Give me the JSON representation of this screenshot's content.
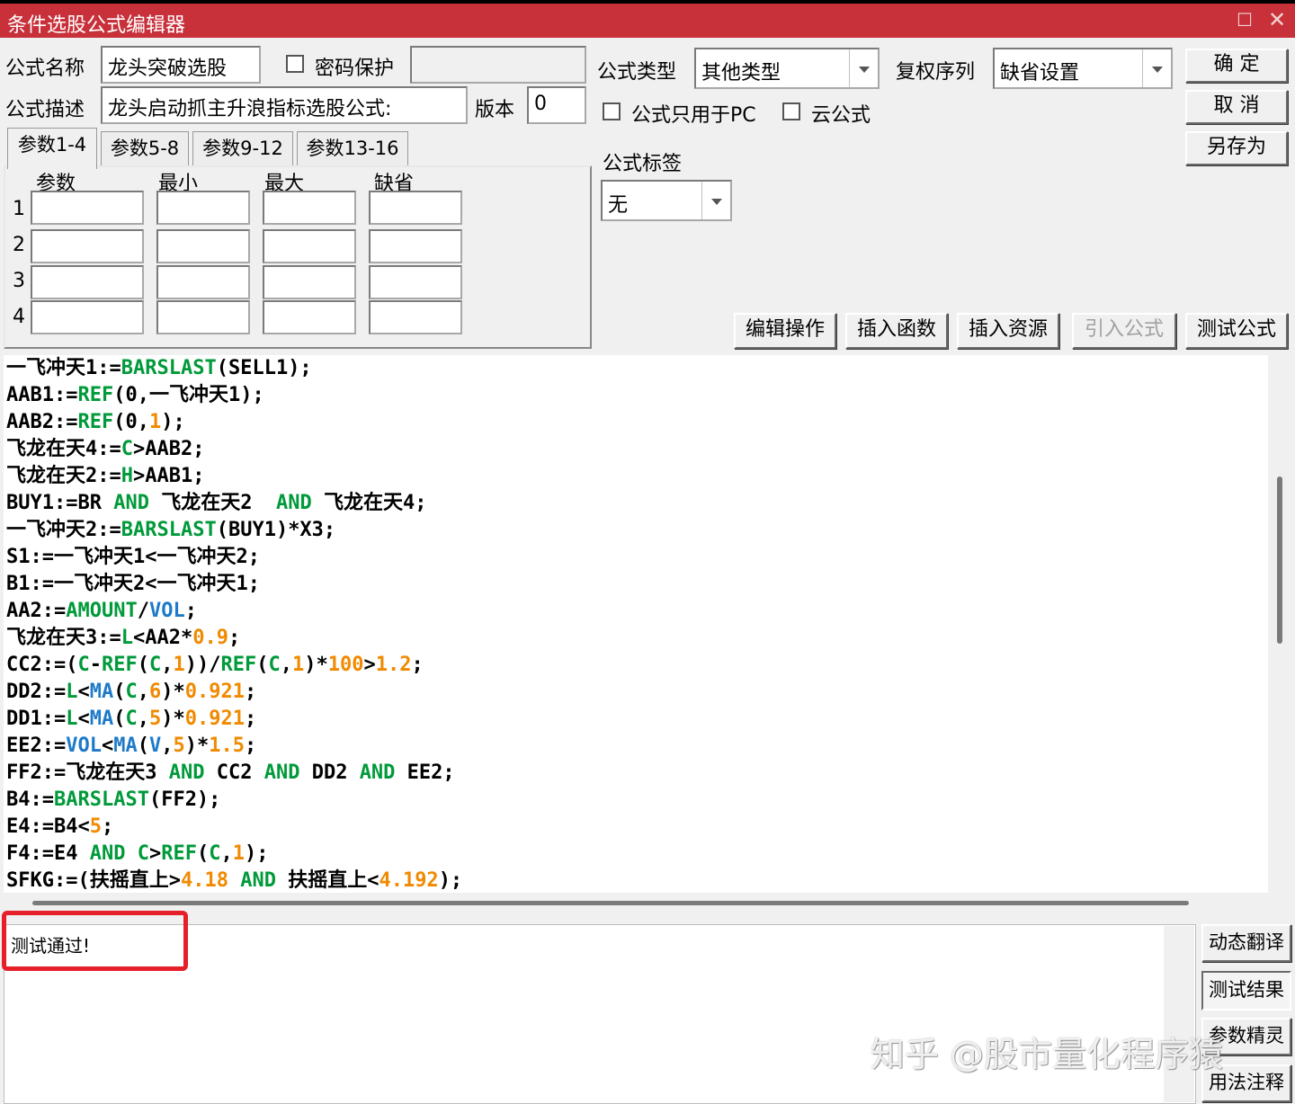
{
  "window": {
    "title": "条件选股公式编辑器",
    "max_glyph": "☐",
    "close_glyph": "✕"
  },
  "header": {
    "name_label": "公式名称",
    "name_value": "龙头突破选股",
    "password_label": "密码保护",
    "password_value": "",
    "desc_label": "公式描述",
    "desc_value": "龙头启动抓主升浪指标选股公式:",
    "version_label": "版本",
    "version_value": "0",
    "type_label": "公式类型",
    "type_value": "其他类型",
    "rights_label": "复权序列",
    "rights_value": "缺省设置",
    "pc_only_label": "公式只用于PC",
    "cloud_label": "云公式",
    "tag_label": "公式标签",
    "tag_value": "无"
  },
  "side_buttons": {
    "ok": "确 定",
    "cancel": "取 消",
    "save_as": "另存为"
  },
  "tabs": [
    "参数1-4",
    "参数5-8",
    "参数9-12",
    "参数13-16"
  ],
  "params": {
    "headers": [
      "参数",
      "最小",
      "最大",
      "缺省"
    ],
    "rows": [
      "1",
      "2",
      "3",
      "4"
    ]
  },
  "toolbar": {
    "edit_ops": "编辑操作",
    "insert_func": "插入函数",
    "insert_res": "插入资源",
    "import_formula": "引入公式",
    "test_formula": "测试公式"
  },
  "code_lines": [
    [
      [
        "t",
        "一飞冲天1:="
      ],
      [
        "f",
        "BARSLAST"
      ],
      [
        "t",
        "(SELL1);"
      ]
    ],
    [
      [
        "t",
        "AAB1:="
      ],
      [
        "f",
        "REF"
      ],
      [
        "t",
        "(0,一飞冲天1);"
      ]
    ],
    [
      [
        "t",
        "AAB2:="
      ],
      [
        "f",
        "REF"
      ],
      [
        "t",
        "(0,"
      ],
      [
        "n",
        "1"
      ],
      [
        "t",
        ");"
      ]
    ],
    [
      [
        "t",
        "飞龙在天4:="
      ],
      [
        "f",
        "C"
      ],
      [
        "t",
        ">AAB2;"
      ]
    ],
    [
      [
        "t",
        "飞龙在天2:="
      ],
      [
        "f",
        "H"
      ],
      [
        "t",
        ">AAB1;"
      ]
    ],
    [
      [
        "t",
        "BUY1:=BR "
      ],
      [
        "f",
        "AND"
      ],
      [
        "t",
        " 飞龙在天2  "
      ],
      [
        "f",
        "AND"
      ],
      [
        "t",
        " 飞龙在天4;"
      ]
    ],
    [
      [
        "t",
        "一飞冲天2:="
      ],
      [
        "f",
        "BARSLAST"
      ],
      [
        "t",
        "(BUY1)*X3;"
      ]
    ],
    [
      [
        "t",
        "S1:=一飞冲天1<一飞冲天2;"
      ]
    ],
    [
      [
        "t",
        "B1:=一飞冲天2<一飞冲天1;"
      ]
    ],
    [
      [
        "t",
        "AA2:="
      ],
      [
        "f",
        "AMOUNT"
      ],
      [
        "t",
        "/"
      ],
      [
        "s",
        "VOL"
      ],
      [
        "t",
        ";"
      ]
    ],
    [
      [
        "t",
        "飞龙在天3:="
      ],
      [
        "f",
        "L"
      ],
      [
        "t",
        "<AA2*"
      ],
      [
        "n",
        "0.9"
      ],
      [
        "t",
        ";"
      ]
    ],
    [
      [
        "t",
        "CC2:=("
      ],
      [
        "f",
        "C"
      ],
      [
        "t",
        "-"
      ],
      [
        "f",
        "REF"
      ],
      [
        "t",
        "("
      ],
      [
        "f",
        "C"
      ],
      [
        "t",
        ","
      ],
      [
        "n",
        "1"
      ],
      [
        "t",
        "))/"
      ],
      [
        "f",
        "REF"
      ],
      [
        "t",
        "("
      ],
      [
        "f",
        "C"
      ],
      [
        "t",
        ","
      ],
      [
        "n",
        "1"
      ],
      [
        "t",
        ")*"
      ],
      [
        "n",
        "100"
      ],
      [
        "t",
        ">"
      ],
      [
        "n",
        "1.2"
      ],
      [
        "t",
        ";"
      ]
    ],
    [
      [
        "t",
        "DD2:="
      ],
      [
        "f",
        "L"
      ],
      [
        "t",
        "<"
      ],
      [
        "s",
        "MA"
      ],
      [
        "t",
        "("
      ],
      [
        "f",
        "C"
      ],
      [
        "t",
        ","
      ],
      [
        "n",
        "6"
      ],
      [
        "t",
        ")*"
      ],
      [
        "n",
        "0.921"
      ],
      [
        "t",
        ";"
      ]
    ],
    [
      [
        "t",
        "DD1:="
      ],
      [
        "f",
        "L"
      ],
      [
        "t",
        "<"
      ],
      [
        "s",
        "MA"
      ],
      [
        "t",
        "("
      ],
      [
        "f",
        "C"
      ],
      [
        "t",
        ","
      ],
      [
        "n",
        "5"
      ],
      [
        "t",
        ")*"
      ],
      [
        "n",
        "0.921"
      ],
      [
        "t",
        ";"
      ]
    ],
    [
      [
        "t",
        "EE2:="
      ],
      [
        "s",
        "VOL"
      ],
      [
        "t",
        "<"
      ],
      [
        "s",
        "MA"
      ],
      [
        "t",
        "("
      ],
      [
        "s",
        "V"
      ],
      [
        "t",
        ","
      ],
      [
        "n",
        "5"
      ],
      [
        "t",
        ")*"
      ],
      [
        "n",
        "1.5"
      ],
      [
        "t",
        ";"
      ]
    ],
    [
      [
        "t",
        "FF2:=飞龙在天3 "
      ],
      [
        "f",
        "AND"
      ],
      [
        "t",
        " CC2 "
      ],
      [
        "f",
        "AND"
      ],
      [
        "t",
        " DD2 "
      ],
      [
        "f",
        "AND"
      ],
      [
        "t",
        " EE2;"
      ]
    ],
    [
      [
        "t",
        "B4:="
      ],
      [
        "f",
        "BARSLAST"
      ],
      [
        "t",
        "(FF2);"
      ]
    ],
    [
      [
        "t",
        "E4:=B4<"
      ],
      [
        "n",
        "5"
      ],
      [
        "t",
        ";"
      ]
    ],
    [
      [
        "t",
        "F4:=E4 "
      ],
      [
        "f",
        "AND"
      ],
      [
        "t",
        " "
      ],
      [
        "f",
        "C"
      ],
      [
        "t",
        ">"
      ],
      [
        "f",
        "REF"
      ],
      [
        "t",
        "("
      ],
      [
        "f",
        "C"
      ],
      [
        "t",
        ","
      ],
      [
        "n",
        "1"
      ],
      [
        "t",
        ");"
      ]
    ],
    [
      [
        "t",
        "SFKG:=(扶摇直上>"
      ],
      [
        "n",
        "4.18"
      ],
      [
        "t",
        " "
      ],
      [
        "f",
        "AND"
      ],
      [
        "t",
        " 扶摇直上<"
      ],
      [
        "n",
        "4.192"
      ],
      [
        "t",
        ");"
      ]
    ]
  ],
  "output": {
    "message": "测试通过!"
  },
  "bottom_buttons": {
    "dyn_translate": "动态翻译",
    "test_result": "测试结果",
    "param_wizard": "参数精灵",
    "usage_notes": "用法注释"
  },
  "watermark": "知乎 @股市量化程序猿"
}
